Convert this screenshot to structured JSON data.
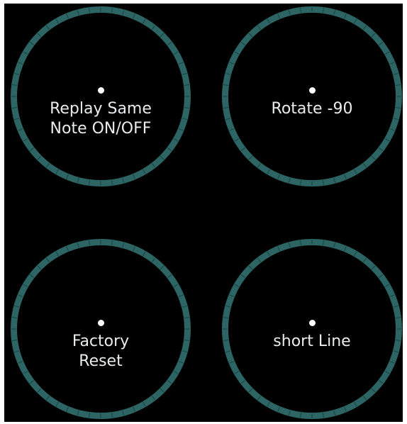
{
  "knobs": [
    {
      "label": "Replay Same\nNote ON/OFF"
    },
    {
      "label": "Rotate -90"
    },
    {
      "label": "Factory\nReset"
    },
    {
      "label": "short Line"
    }
  ],
  "colors": {
    "background": "#000000",
    "ring": "#2c6564",
    "tick": "#1b3f3e",
    "text": "#e8ecec",
    "dot": "#ffffff"
  }
}
